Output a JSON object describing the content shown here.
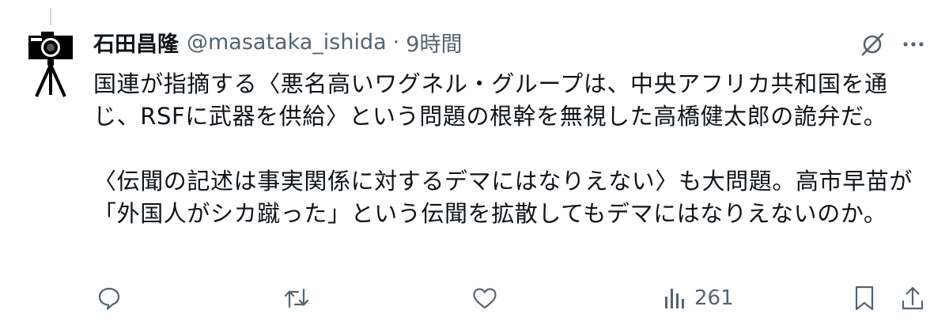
{
  "tweet": {
    "author_name": "石田昌隆",
    "handle": "@masataka_ishida",
    "separator": "·",
    "time": "9時間",
    "paragraphs": [
      "国連が指摘する〈悪名高いワグネル・グループは、中央アフリカ共和国を通じ、RSFに武器を供給〉という問題の根幹を無視した高橋健太郎の詭弁だ。",
      "〈伝聞の記述は事実関係に対するデマにはなりえない〉も大問題。高市早苗が「外国人がシカ蹴った」という伝聞を拡散してもデマにはなりえないのか。"
    ]
  },
  "actions": {
    "reply_icon": "reply-icon",
    "retweet_icon": "retweet-icon",
    "like_icon": "heart-icon",
    "views_icon": "views-icon",
    "views_count": "261",
    "bookmark_icon": "bookmark-icon",
    "share_icon": "share-icon"
  },
  "colors": {
    "text": "#0f1419",
    "secondary": "#536471",
    "thread_line": "#cfd9de"
  }
}
